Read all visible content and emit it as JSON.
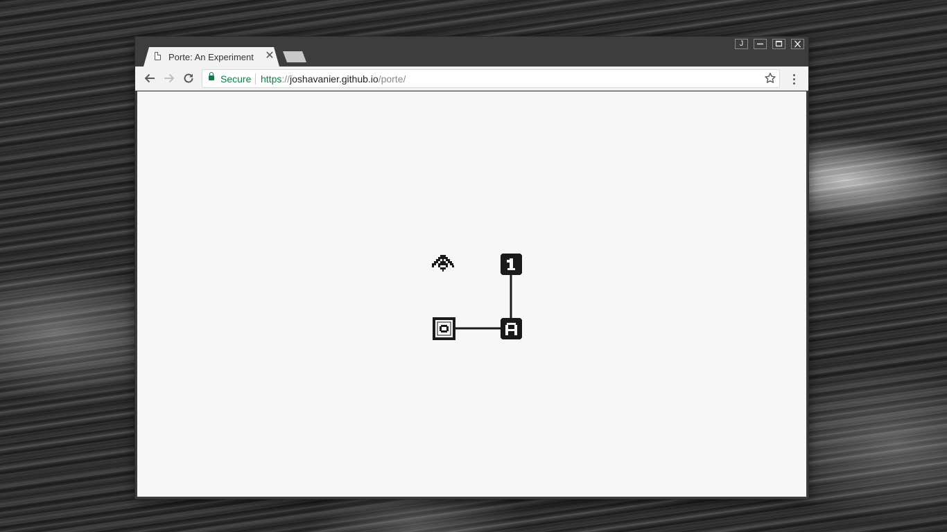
{
  "browser": {
    "tab": {
      "title": "Porte: An Experiment",
      "close_glyph": "✕"
    },
    "window_controls": {
      "user_label": "J",
      "minimize": "–",
      "maximize": "□",
      "close": "✕"
    },
    "address_bar": {
      "security_label": "Secure",
      "url_scheme": "https",
      "url_separator": "://",
      "url_host": "joshavanier.github.io",
      "url_path": "/porte/"
    },
    "icons": {
      "tab": "page-icon",
      "back": "arrow-left-icon",
      "forward": "arrow-right-icon",
      "reload": "reload-icon",
      "security": "lock-icon",
      "bookmark": "star-icon",
      "menu": "kebab-menu-icon"
    }
  },
  "game": {
    "nodes": [
      {
        "id": "player",
        "kind": "player-sprite"
      },
      {
        "id": "node-1",
        "label": "1"
      },
      {
        "id": "node-a",
        "label": "A"
      },
      {
        "id": "node-o",
        "label": "O"
      }
    ],
    "links": [
      [
        "node-1",
        "node-a"
      ],
      [
        "node-o",
        "node-a"
      ]
    ]
  },
  "colors": {
    "titlebar": "#3d3d3d",
    "toolbar": "#f2f2f2",
    "secure_green": "#0b8043",
    "page_background": "#f7f7f7",
    "glyph": "#1a1a1a"
  }
}
